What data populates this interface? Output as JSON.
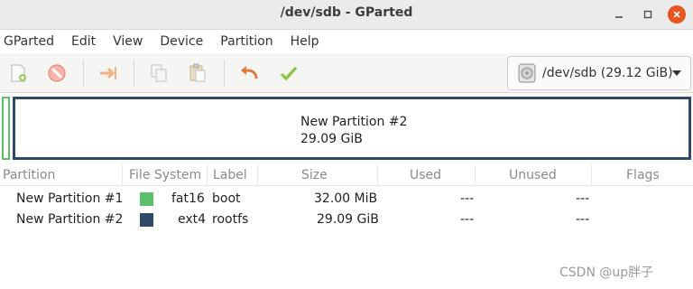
{
  "window": {
    "title": "/dev/sdb - GParted"
  },
  "menu": [
    "GParted",
    "Edit",
    "View",
    "Device",
    "Partition",
    "Help"
  ],
  "toolbar": {
    "icons": [
      "new-partition-icon",
      "delete-icon",
      "resize-move-icon",
      "copy-icon",
      "paste-icon",
      "undo-icon",
      "apply-icon"
    ],
    "device_label": "/dev/sdb  (29.12 GiB)"
  },
  "diskmap": {
    "selected_name": "New Partition #2",
    "selected_size": "29.09 GiB",
    "colors": {
      "fat16": "#5ac06b",
      "ext4": "#2f4a67"
    }
  },
  "table": {
    "headers": [
      "Partition",
      "File System",
      "Label",
      "Size",
      "Used",
      "Unused",
      "Flags"
    ],
    "rows": [
      {
        "partition": "New Partition #1",
        "fs": "fat16",
        "fs_color": "#5ac06b",
        "label": "boot",
        "size": "32.00 MiB",
        "used": "---",
        "unused": "---",
        "flags": ""
      },
      {
        "partition": "New Partition #2",
        "fs": "ext4",
        "fs_color": "#2f4a67",
        "label": "rootfs",
        "size": "29.09 GiB",
        "used": "---",
        "unused": "---",
        "flags": ""
      }
    ]
  },
  "watermark": "CSDN @up胖子"
}
